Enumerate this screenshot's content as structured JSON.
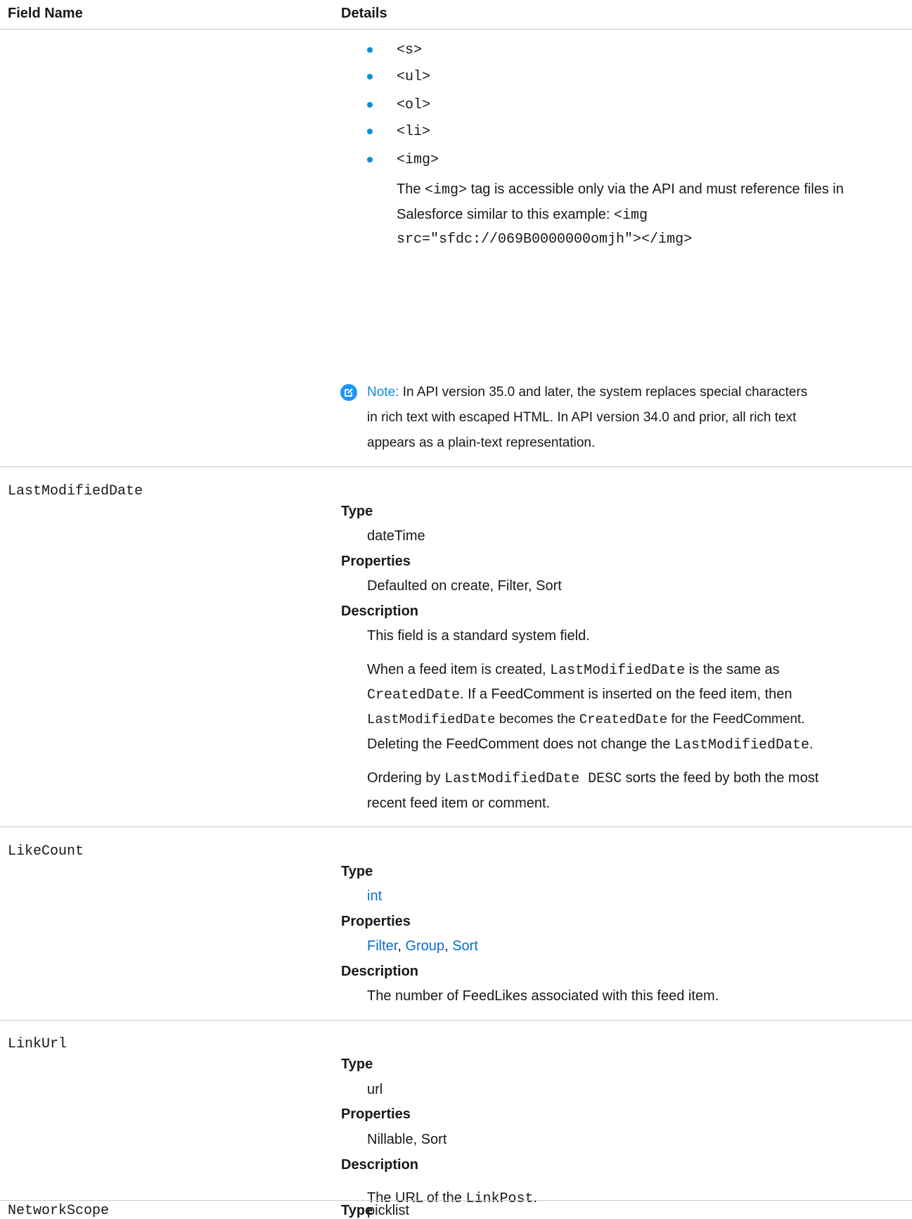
{
  "header": {
    "field_name": "Field Name",
    "details": "Details"
  },
  "bullets": [
    "<s>",
    "<ul>",
    "<ol>",
    "<li>",
    "<img>"
  ],
  "img_note": {
    "p1_a": "The ",
    "p1_code": "<img>",
    "p1_b": " tag is accessible only via the API and must reference files in",
    "p2_a": "Salesforce similar to this example: ",
    "p2_code": "<img",
    "p3_code": "src=\"sfdc://069B0000000omjh\"></img>"
  },
  "note": {
    "label": "Note:",
    "line1": "In API version 35.0 and later, the system replaces special characters",
    "line2": "in rich text with escaped HTML. In API version 34.0 and prior, all rich text",
    "line3": "appears as a plain-text representation."
  },
  "fields": {
    "lastModified": {
      "name": "LastModifiedDate",
      "type_label": "Type",
      "type": "dateTime",
      "props_label": "Properties",
      "props": "Defaulted on create, Filter, Sort",
      "desc_label": "Description",
      "desc1": "This field is a standard system field.",
      "d2_a": "When a feed item is created, ",
      "d2_code1": "LastModifiedDate",
      "d2_b": " is the same as",
      "d3_code1": "CreatedDate",
      "d3_b": ". If a FeedComment is inserted on the feed item, then",
      "d4_code1": "LastModifiedDate",
      "d4_b": " becomes the ",
      "d4_code2": "CreatedDate",
      "d4_c": " for the FeedComment.",
      "d5_a": "Deleting the FeedComment does not change the ",
      "d5_code": "LastModifiedDate",
      "d5_b": ".",
      "d6_a": "Ordering by ",
      "d6_code": "LastModifiedDate DESC",
      "d6_b": " sorts the feed by both the most",
      "d7": "recent feed item or comment."
    },
    "likeCount": {
      "name": "LikeCount",
      "type_label": "Type",
      "type": "int",
      "props_label": "Properties",
      "prop1": "Filter",
      "sep1": ", ",
      "prop2": "Group",
      "sep2": ", ",
      "prop3": "Sort",
      "desc_label": "Description",
      "desc": "The number of FeedLikes associated with this feed item."
    },
    "linkUrl": {
      "name": "LinkUrl",
      "type_label": "Type",
      "type": "url",
      "props_label": "Properties",
      "props": "Nillable, Sort",
      "desc_label": "Description",
      "desc_a": "The URL of the ",
      "desc_code": "LinkPost",
      "desc_b": "."
    },
    "networkScope": {
      "name": "NetworkScope",
      "type_label": "Type",
      "type": "picklist"
    }
  },
  "colors": {
    "link": "#0b6cd1",
    "bullet": "#0b8fd7",
    "note_icon": "#1b96ff",
    "divider": "#c9c9c9"
  },
  "icons": {
    "note": "edit-note-icon"
  }
}
